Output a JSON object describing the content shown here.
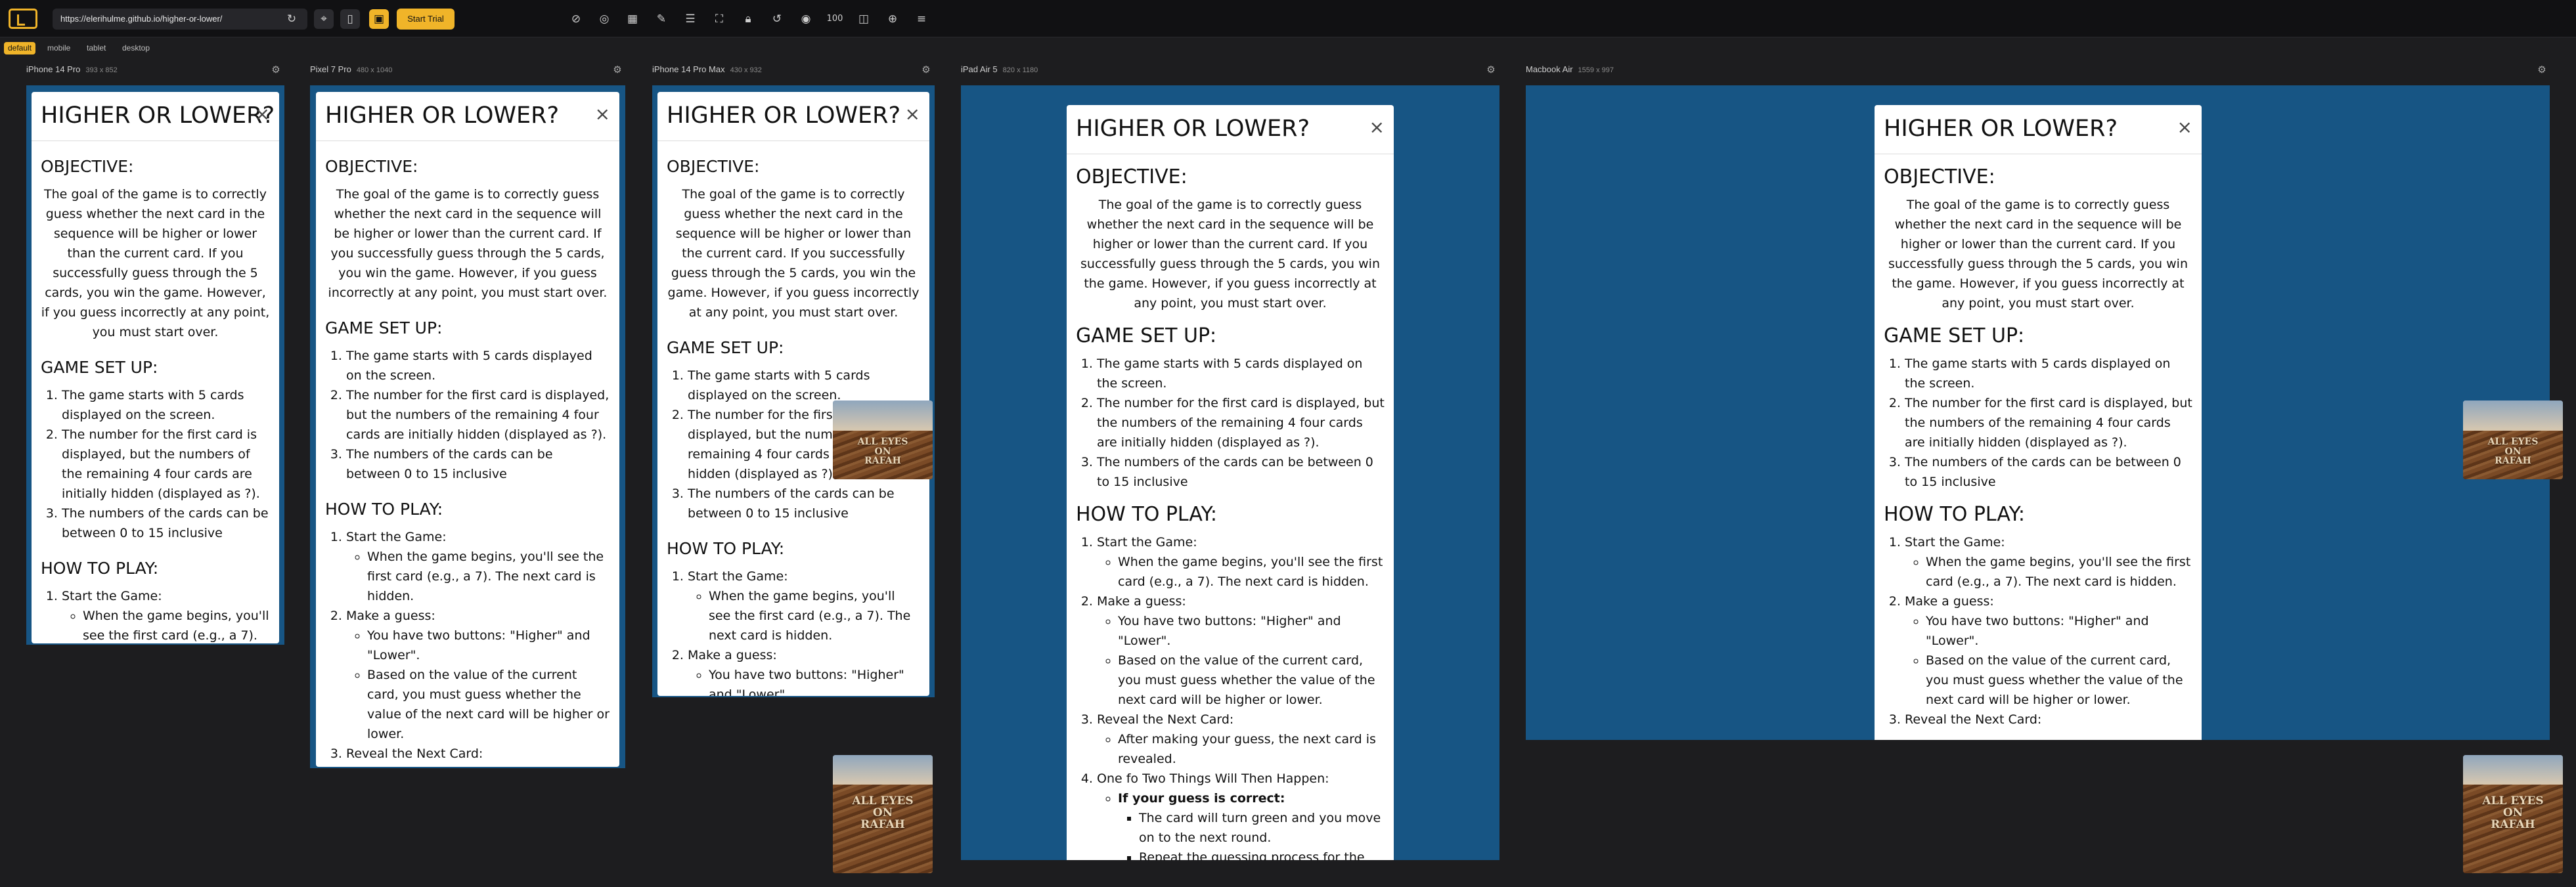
{
  "toolbar": {
    "url": "https://elerihulme.github.io/higher-or-lower/",
    "zoom": "100",
    "trial_label": "Start Trial",
    "icons": [
      "reload-icon",
      "cursor-icon",
      "mobile-icon",
      "devices-icon",
      "sync-icon",
      "palette-icon",
      "grid-icon",
      "ruler-icon",
      "list-icon",
      "fullscreen-icon",
      "lock-icon",
      "history-icon",
      "camera-icon",
      "split-icon",
      "compass-icon",
      "menu-icon"
    ]
  },
  "tabs": [
    "default",
    "mobile",
    "tablet",
    "desktop"
  ],
  "devices": [
    {
      "name": "iPhone 14 Pro",
      "dims": "393 x 852"
    },
    {
      "name": "Pixel 7 Pro",
      "dims": "480 x 1040"
    },
    {
      "name": "iPhone 14 Pro Max",
      "dims": "430 x 932"
    },
    {
      "name": "iPad Air 5",
      "dims": "820 x 1180"
    },
    {
      "name": "Macbook Air",
      "dims": "1559 x 997"
    }
  ],
  "modal": {
    "title": "HIGHER OR LOWER?",
    "close": "×",
    "objective_heading": "OBJECTIVE:",
    "objective_text": "The goal of the game is to correctly guess whether the next card in the sequence will be higher or lower than the current card. If you successfully guess through the 5 cards, you win the game. However, if you guess incorrectly at any point, you must start over.",
    "setup_heading": "GAME SET UP:",
    "setup_items": [
      "The game starts with 5 cards displayed on the screen.",
      "The number for the first card is displayed, but the numbers of the remaining 4 four cards are initially hidden (displayed as ?).",
      "The numbers of the cards can be between 0 to 15 inclusive"
    ],
    "howto_heading": "HOW TO PLAY:",
    "steps": [
      {
        "label": "Start the Game:",
        "sub": [
          "When the game begins, you'll see the first card (e.g., a 7). The next card is hidden."
        ]
      },
      {
        "label": "Make a guess:",
        "sub": [
          "You have two buttons: \"Higher\" and \"Lower\".",
          "Based on the value of the current card, you must guess whether the value of the next card will be higher or lower."
        ]
      },
      {
        "label": "Reveal the Next Card:",
        "sub": [
          "After making your guess, the next card is revealed."
        ]
      },
      {
        "label": "One fo Two Things Will Then Happen:",
        "correct_label": "If your guess is correct:",
        "correct_sub": [
          "The card will turn green and you move on to the next round.",
          "Repeat the guessing process for the new"
        ]
      }
    ]
  },
  "thumbnail": {
    "text_line1": "ALL EYES",
    "text_line2": "ON",
    "text_line3": "RAFAH"
  }
}
